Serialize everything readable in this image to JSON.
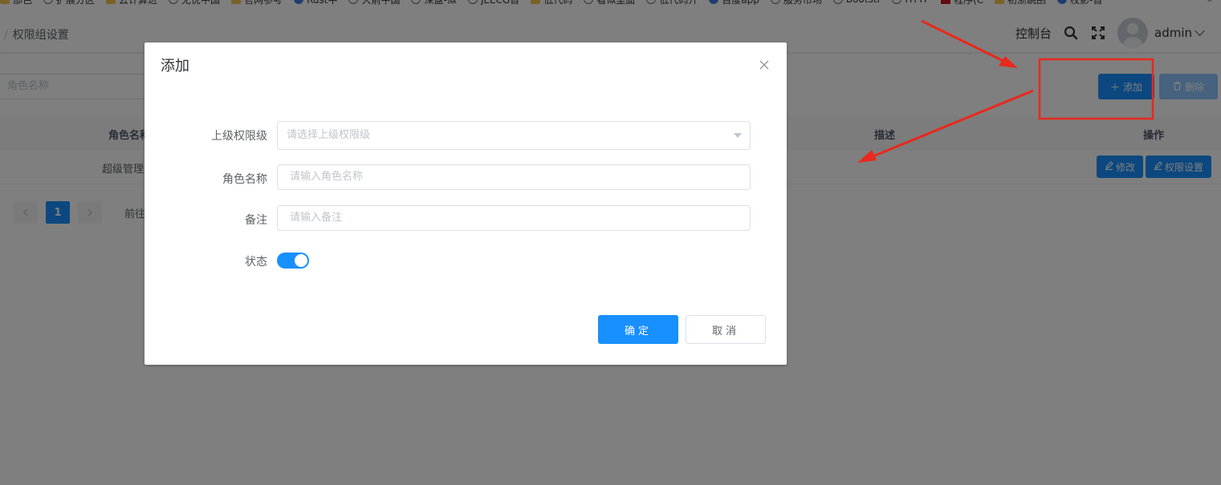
{
  "bookmarks": [
    {
      "label": "部色",
      "icon": "folder-icon"
    },
    {
      "label": "扩展分区",
      "icon": "globe-icon"
    },
    {
      "label": "云计算进",
      "icon": "folder-icon"
    },
    {
      "label": "无忧中国",
      "icon": "globe-icon"
    },
    {
      "label": "官网参考",
      "icon": "folder-icon"
    },
    {
      "label": "Rust中",
      "icon": "blue-icon"
    },
    {
      "label": "大前中国",
      "icon": "globe-icon"
    },
    {
      "label": "深盘-似",
      "icon": "globe-icon"
    },
    {
      "label": "JEECG首",
      "icon": "globe-icon"
    },
    {
      "label": "低代码",
      "icon": "folder-icon"
    },
    {
      "label": "看似里面",
      "icon": "globe-icon"
    },
    {
      "label": "低代码开",
      "icon": "globe-icon"
    },
    {
      "label": "百度app",
      "icon": "blue-icon"
    },
    {
      "label": "服务市场",
      "icon": "globe-icon"
    },
    {
      "label": "Bootstr",
      "icon": "globe-icon"
    },
    {
      "label": "HTTP",
      "icon": "globe-icon"
    },
    {
      "label": "程序(C",
      "icon": "red-icon"
    },
    {
      "label": "初浙跳刮",
      "icon": "folder-icon"
    },
    {
      "label": "校影-首",
      "icon": "blue-icon"
    }
  ],
  "bookmarks_more": "»",
  "breadcrumb": {
    "sep": "/",
    "current": "权限组设置"
  },
  "header": {
    "dashboard": "控制台",
    "username": "admin"
  },
  "search": {
    "placeholder": "角色名称"
  },
  "toolbar": {
    "add": "添加",
    "delete": "删除"
  },
  "table": {
    "headers": [
      "角色名称",
      "描述",
      "操作"
    ],
    "rows": [
      {
        "name": "超级管理员",
        "edit": "修改",
        "perm": "权限设置"
      }
    ]
  },
  "pager": {
    "page": "1",
    "goto": "前往"
  },
  "dialog": {
    "title": "添加",
    "fields": [
      {
        "label": "上级权限级",
        "placeholder": "请选择上级权限级"
      },
      {
        "label": "角色名称",
        "placeholder": "请输入角色名称"
      },
      {
        "label": "备注",
        "placeholder": "请输入备注"
      },
      {
        "label": "状态"
      }
    ],
    "status_on": true,
    "ok": "确定",
    "cancel": "取消"
  },
  "colors": {
    "primary": "#1890ff",
    "annotation": "#e8291c"
  }
}
